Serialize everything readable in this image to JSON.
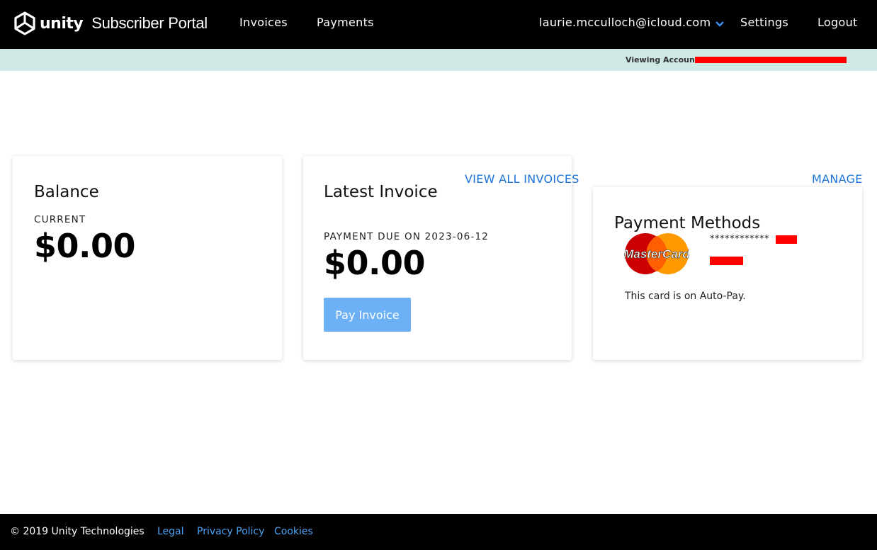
{
  "header": {
    "brand_word": "unity",
    "portal_name": "Subscriber Portal",
    "nav": {
      "invoices": "Invoices",
      "payments": "Payments"
    },
    "user_email": "laurie.mcculloch@icloud.com",
    "settings": "Settings",
    "logout": "Logout"
  },
  "account_bar": {
    "label": "Viewing Account:"
  },
  "balance_card": {
    "title": "Balance",
    "caption": "CURRENT",
    "amount": "$0.00"
  },
  "invoice_card": {
    "view_all_link": "VIEW ALL INVOICES",
    "title": "Latest Invoice",
    "caption": "PAYMENT DUE ON 2023-06-12",
    "amount": "$0.00",
    "pay_button": "Pay Invoice"
  },
  "payment_card": {
    "manage_link": "MANAGE",
    "title": "Payment Methods",
    "card_brand": "MasterCard",
    "card_mask": "************",
    "autopay_text": "This card is on Auto-Pay."
  },
  "footer": {
    "copyright": "© 2019 Unity Technologies",
    "links": [
      "Legal",
      "Privacy Policy",
      "Cookies"
    ]
  },
  "colors": {
    "topbar": "#000000",
    "account_strip": "#cde8e5",
    "link": "#1a73d9",
    "button": "#6cb1f5",
    "redaction": "#ff0000"
  }
}
